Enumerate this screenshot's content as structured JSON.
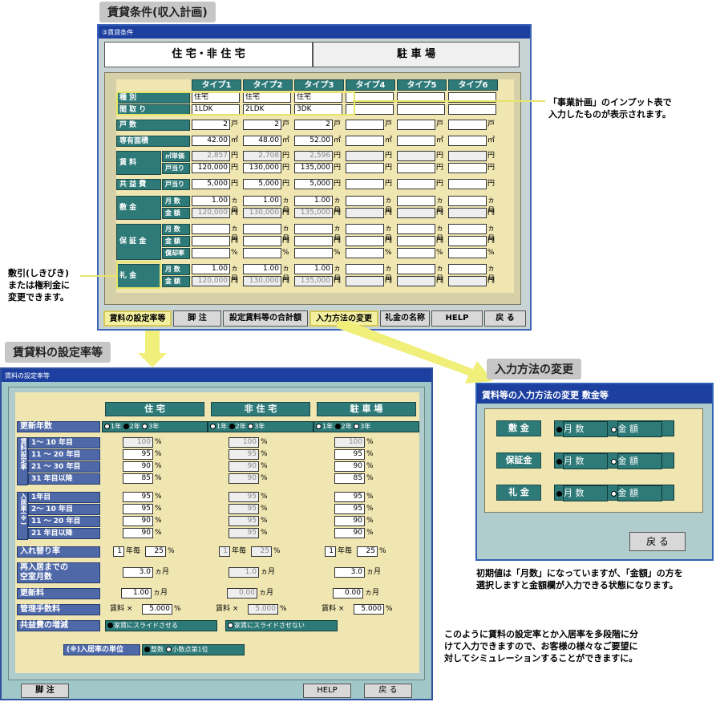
{
  "tags": {
    "top": "賃貸条件(収入計画)",
    "left": "賃貸料の設定率等",
    "right": "入力方法の変更"
  },
  "w1": {
    "title": "③賃貸条件",
    "tab1": "住 宅・非 住 宅",
    "tab2": "駐 車 場",
    "types": [
      "タイプ1",
      "タイプ2",
      "タイプ3",
      "タイプ4",
      "タイプ5",
      "タイプ6"
    ],
    "shubetsu": "種 別",
    "madori": "間 取 り",
    "kosu": "戸 数",
    "senyu": "専有面積",
    "chinryo": "賃 料",
    "m2tanka": "㎡単価",
    "kotari": "戸当り",
    "kyoeki": "共 益 費",
    "kyoeki_sub": "戸当り",
    "shikikin": "敷 金",
    "hoshokin": "保 証 金",
    "reikin": "礼 金",
    "tsukisu": "月 数",
    "kingaku": "金 額",
    "shokyaku": "償却率",
    "row_shubetsu": [
      "住宅",
      "住宅",
      "住宅",
      "",
      "",
      ""
    ],
    "row_madori": [
      "1LDK",
      "2LDK",
      "3DK",
      "",
      "",
      ""
    ],
    "row_kosu": [
      "2",
      "2",
      "2",
      "",
      "",
      ""
    ],
    "row_area": [
      "42.00",
      "48.00",
      "52.00",
      "",
      "",
      ""
    ],
    "row_m2": [
      "2,857",
      "2,708",
      "2,596",
      "",
      "",
      ""
    ],
    "row_rent": [
      "120,000",
      "130,000",
      "135,000",
      "",
      "",
      ""
    ],
    "row_common": [
      "5,000",
      "5,000",
      "5,000",
      "",
      "",
      ""
    ],
    "row_shiki_m": [
      "1.00",
      "1.00",
      "1.00",
      "",
      "",
      ""
    ],
    "row_shiki_k": [
      "120,000",
      "130,000",
      "135,000",
      "",
      "",
      ""
    ],
    "row_rei_m": [
      "1.00",
      "1.00",
      "1.00",
      "",
      "",
      ""
    ],
    "row_rei_k": [
      "120,000",
      "130,000",
      "135,000",
      "",
      "",
      ""
    ],
    "u_ko": "戸",
    "u_m2": "㎡",
    "u_yen": "円",
    "u_kagetsu": "ヵ月",
    "u_pct": "%",
    "buttons": [
      "賃料の設定率等",
      "脚 注",
      "設定賃料等の合計額",
      "入力方法の変更",
      "礼金の名称",
      "HELP",
      "戻 る"
    ]
  },
  "notes": {
    "n1": "「事業計画」のインプット表で\n入力したものが表示されます。",
    "n2": "敷引(しきびき)\nまたは権利金に\n変更できます。",
    "n3": "初期値は「月数」になっていますが、「金額」の方を\n選択しますと金額欄が入力できる状態になります。",
    "n4": "このように賃料の設定率とか入居率を多段階に分\nけて入力できますので、お客様の様々なご要望に\n対してシミュレーションすることができますに。"
  },
  "w2": {
    "title": "賃料の設定率等",
    "cols": [
      "住 宅",
      "非 住 宅",
      "駐 車 場"
    ],
    "koshin": "更新年数",
    "r1": "1年",
    "r2": "2年",
    "r3": "3年",
    "chinryo_v": "賃料設定率",
    "nyukyo_v": "入居率(※)",
    "c_rows": [
      "1～ 10 年目",
      "11 ～ 20 年目",
      "21 ～ 30 年目",
      "31 年目以降"
    ],
    "n_rows": [
      "1年目",
      "2～ 10 年目",
      "11 ～ 20 年目",
      "21 年目以降"
    ],
    "c_vals": [
      [
        "100",
        "95",
        "90",
        "85"
      ],
      [
        "100",
        "95",
        "90",
        "90"
      ],
      [
        "100",
        "95",
        "90",
        "85"
      ]
    ],
    "n_vals": [
      [
        "95",
        "95",
        "90",
        "90"
      ],
      [
        "95",
        "95",
        "95",
        "95"
      ],
      [
        "95",
        "95",
        "90",
        "90"
      ]
    ],
    "irekawari": "入れ替り率",
    "ire_val": "1",
    "ire_unit": "年毎",
    "ire_pct": "25",
    "sai_nyukyo": "再入居までの\n空室月数",
    "sai_vals": [
      "3.0",
      "1.0",
      "3.0"
    ],
    "koshinryo": "更新料",
    "koshin_vals": [
      "1.00",
      "0.00",
      "0.00"
    ],
    "kanri": "管理手数料",
    "kanri_vals": [
      "5.000",
      "5.000",
      "5.000"
    ],
    "kanri_pre": "賃料 ×",
    "zougen": "共益費の増減",
    "slide_on": "家賃にスライドさせる",
    "slide_off": "家賃にスライドさせない",
    "unit_label": "(※)入居率の単位",
    "seisu": "整数",
    "shosu": "小数点第1位",
    "btn_kyakuchu": "脚 注",
    "btn_help": "HELP",
    "btn_back": "戻 る"
  },
  "w3": {
    "title": "賃料等の入力方法の変更 敷金等",
    "rows": [
      "敷 金",
      "保証金",
      "礼 金"
    ],
    "opt1": "月 数",
    "opt2": "金 額",
    "back": "戻 る"
  }
}
